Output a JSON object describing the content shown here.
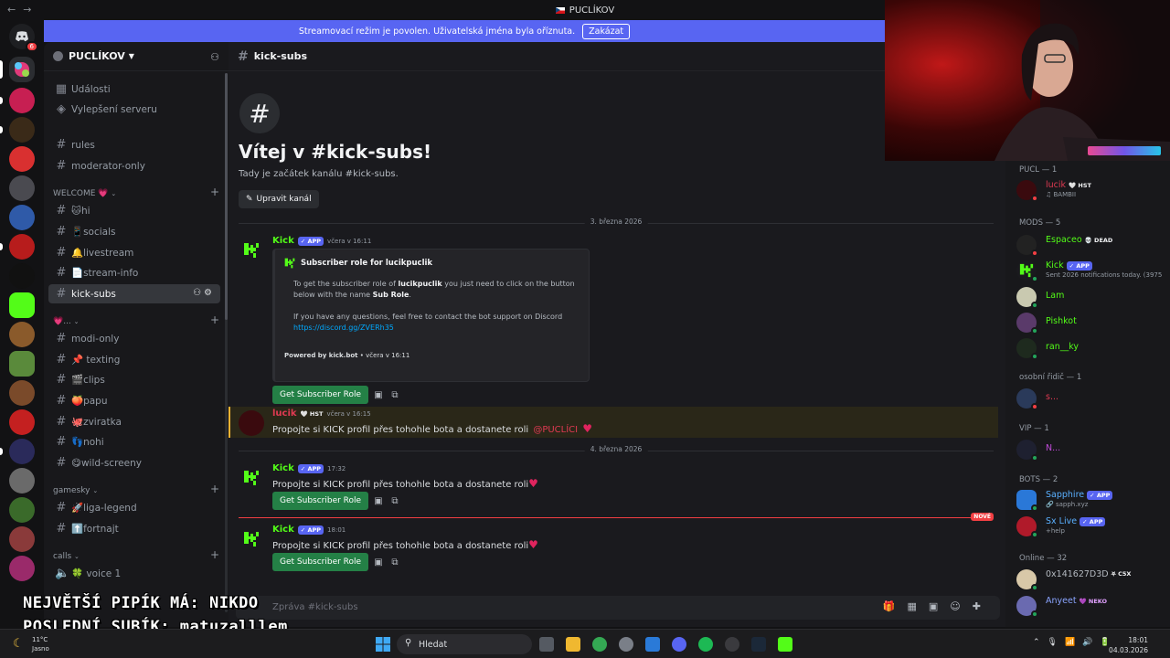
{
  "window": {
    "title": "PUCLÍKOV"
  },
  "banner": {
    "text": "Streamovací režim je povolen. Uživatelská jména byla oříznuta.",
    "button": "Zakázat"
  },
  "server": {
    "name": "PUCLÍKOV",
    "top_items": [
      "Události",
      "Vylepšení serveru"
    ],
    "channels_top": [
      "rules",
      "moderator-only"
    ],
    "cat_welcome": "WELCOME 💗",
    "welcome_channels": [
      "🐱hi",
      "📱socials",
      "🔔livestream",
      "📄stream-info",
      "kick-subs"
    ],
    "cat_second": "💗...",
    "second_channels": [
      "modi-only",
      "📌 texting",
      "🎬clips",
      "🍑papu",
      "🐙zviratka",
      "👣nohi",
      "😋wild-screeny"
    ],
    "cat_gamesky": "gamesky",
    "gamesky_channels": [
      "🚀liga-legend",
      "⬆️fortnajt"
    ],
    "cat_calls": "calls",
    "voice_channel": "🍀 voice 1"
  },
  "channel": {
    "name": "kick-subs",
    "welcome_title": "Vítej v #kick-subs!",
    "welcome_sub": "Tady je začátek kanálu #kick-subs.",
    "edit_button": "Upravit kanál"
  },
  "messages": {
    "date1": "3. března 2026",
    "date2": "4. března 2026",
    "m1": {
      "author": "Kick",
      "tag": "APP",
      "time": "včera v 16:11",
      "embed_title": "Subscriber role for lucikpuclik",
      "embed_line1a": "To get the subscriber role of ",
      "embed_line1b": "lucikpuclik",
      "embed_line1c": " you just need to click on the button",
      "embed_line2a": "below with the name ",
      "embed_line2b": "Sub Role",
      "embed_line2c": ".",
      "embed_line3": "If you have any questions, feel free to contact the bot support on Discord",
      "embed_link": "https://discord.gg/ZVERh35",
      "embed_footer_a": "Powered by kick.bot",
      "embed_footer_b": " • včera v 16:11",
      "button": "Get Subscriber Role"
    },
    "m2": {
      "author": "lucik",
      "tag": "HST",
      "time": "včera v 16:15",
      "text": "Propojte si KICK profil přes tohohle bota a dostanete roli ",
      "mention": "@PUCLÍCI"
    },
    "m3": {
      "author": "Kick",
      "tag": "APP",
      "time": "17:32",
      "text": "Propojte si KICK profil přes tohohle bota a dostanete roli",
      "button": "Get Subscriber Role"
    },
    "new_label": "NOVÉ",
    "m4": {
      "author": "Kick",
      "tag": "APP",
      "time": "18:01",
      "text": "Propojte si KICK profil přes tohohle bota a dostanete roli",
      "button": "Get Subscriber Role"
    }
  },
  "composer": {
    "placeholder": "Zpráva #kick-subs"
  },
  "members": {
    "cat1": "PUCL — 1",
    "cat2": "MODS — 5",
    "cat3": "osobní řidič — 1",
    "cat4": "VIP — 1",
    "cat5": "BOTS — 2",
    "cat6": "Online — 32",
    "lucik": {
      "name": "lucik",
      "tag": "HST",
      "sub": "♫ BAMBII"
    },
    "espaceo": {
      "name": "Espaceo",
      "tag": "DEAD"
    },
    "kick": {
      "name": "Kick",
      "tag": "APP",
      "sub": "Sent 2026 notifications today. (3975"
    },
    "lam": {
      "name": "Lam"
    },
    "pishkot": {
      "name": "Pishkot"
    },
    "ran": {
      "name": "ran__ky"
    },
    "driver": {
      "name": "s..."
    },
    "vip": {
      "name": "N..."
    },
    "sapphire": {
      "name": "Sapphire",
      "tag": "APP",
      "sub": "🔗 sapph.xyz"
    },
    "sxlive": {
      "name": "Sx Live",
      "tag": "APP",
      "sub": "+help"
    },
    "online1": {
      "name": "0x141627D3D",
      "tag": "C5X"
    },
    "online2": {
      "name": "Anyeet",
      "tag": "NEKO"
    }
  },
  "overlay": {
    "line1": "NEJVĚTŠÍ PIPÍK MÁ: NIKDO",
    "line2": "POSLEDNÍ SUBÍK: matuzalllem"
  },
  "taskbar": {
    "temp": "11°C",
    "weather": "Jasno",
    "search": "Hledat",
    "time": "18:01",
    "date": "04.03.2026"
  },
  "colors": {
    "accent": "#5865f2",
    "kick_green": "#53fc18",
    "button_green": "#248046",
    "danger": "#f23f43"
  }
}
